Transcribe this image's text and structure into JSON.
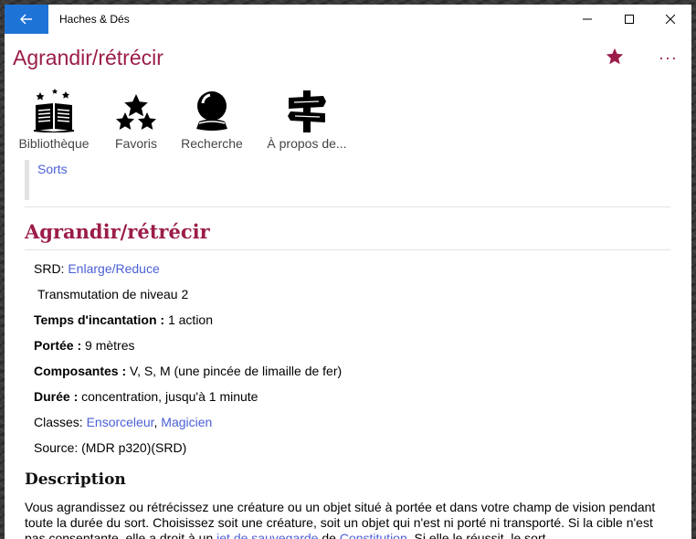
{
  "window": {
    "app_title": "Haches & Dés"
  },
  "header": {
    "title": "Agrandir/rétrécir",
    "more_label": "···"
  },
  "nav": [
    {
      "label": "Bibliothèque",
      "icon": "book-icon"
    },
    {
      "label": "Favoris",
      "icon": "stars-icon"
    },
    {
      "label": "Recherche",
      "icon": "crystal-ball-icon"
    },
    {
      "label": "À propos de...",
      "icon": "signpost-icon"
    }
  ],
  "breadcrumb": {
    "link": "Sorts"
  },
  "spell": {
    "title": "Agrandir/rétrécir",
    "srd_label": "SRD: ",
    "srd_link": "Enlarge/Reduce",
    "school": "Transmutation de niveau 2",
    "casting_time_label": "Temps d'incantation : ",
    "casting_time": "1 action",
    "range_label": "Portée : ",
    "range": "9 mètres",
    "components_label": "Composantes : ",
    "components": "V, S, M (une pincée de limaille de fer)",
    "duration_label": "Durée : ",
    "duration": "concentration, jusqu'à 1 minute",
    "classes_label": "Classes: ",
    "class_1": "Ensorceleur",
    "class_sep": ", ",
    "class_2": "Magicien",
    "source": "Source: (MDR p320)(SRD)"
  },
  "description": {
    "title": "Description",
    "text_1": "Vous agrandissez ou rétrécissez une créature ou un objet situé à portée et dans votre champ de vision pendant toute la durée du sort. Choisissez soit une créature, soit un objet qui n'est ni porté ni transporté. Si la cible n'est pas consentante, elle a droit à un ",
    "link_1": "jet de sauvegarde",
    "text_2": " de ",
    "link_2": "Constitution",
    "text_3": ". Si elle le réussit, le sort"
  },
  "colors": {
    "accent": "#9b1c4a",
    "link": "#4a5fd6",
    "back_button": "#1e73d6"
  }
}
